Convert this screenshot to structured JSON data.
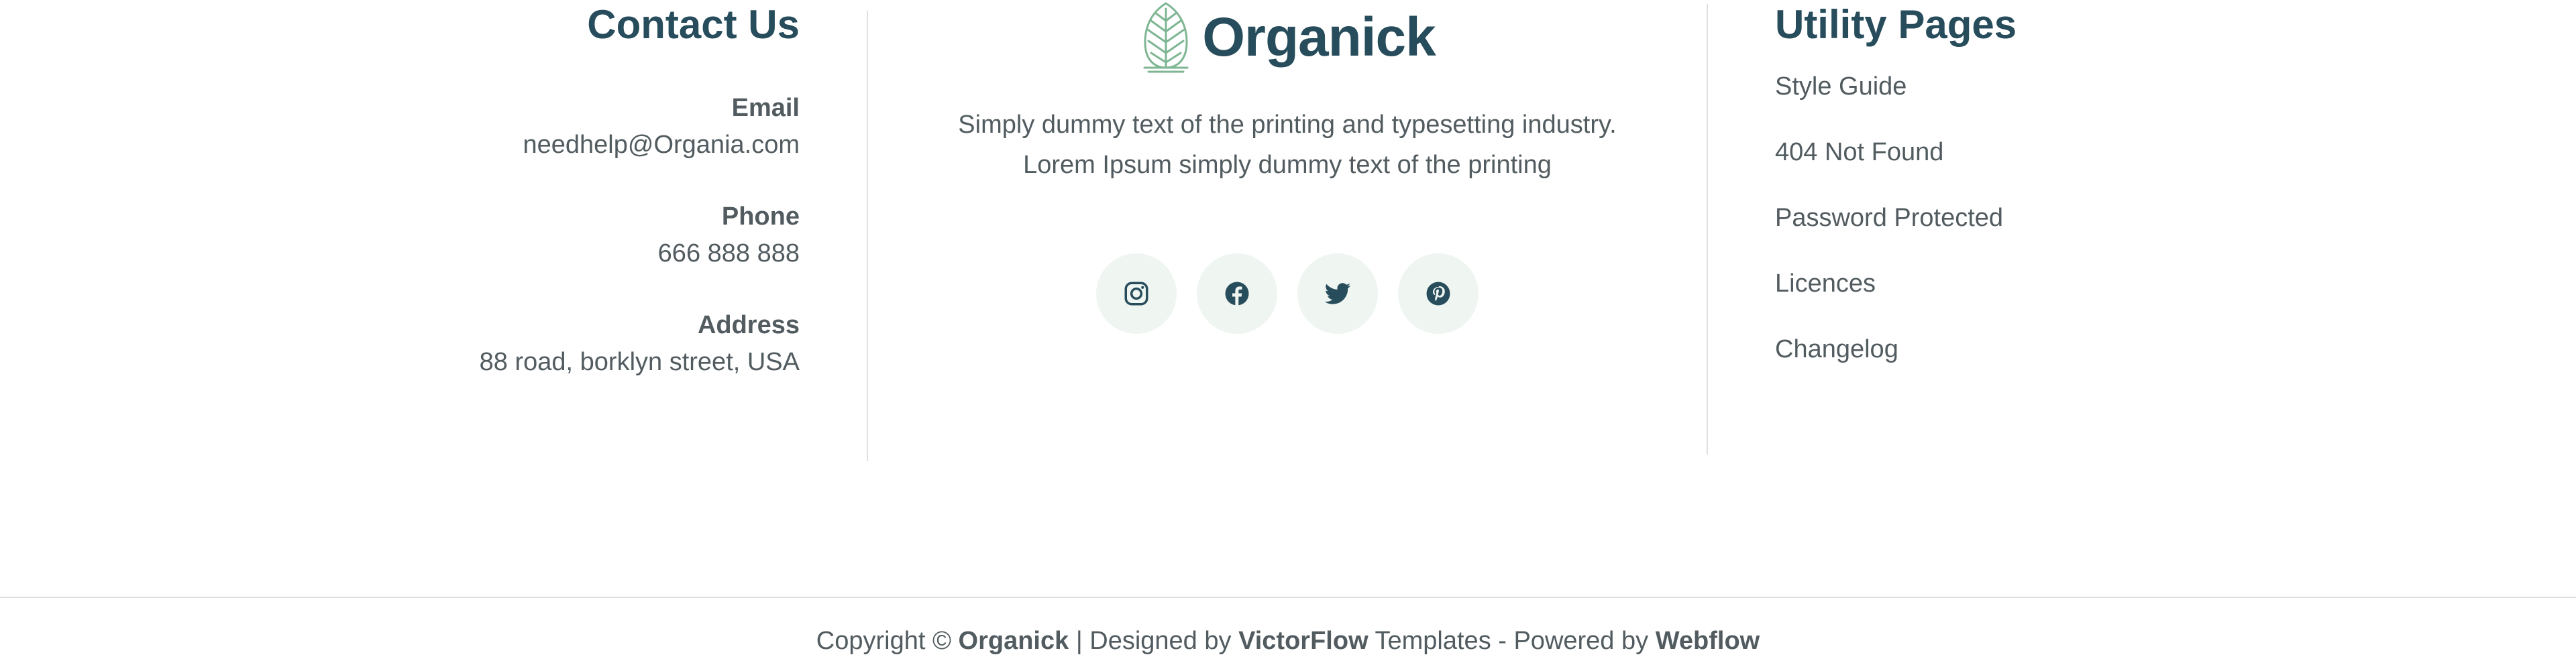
{
  "contact": {
    "heading": "Contact Us",
    "email_label": "Email",
    "email_value": "needhelp@Organia.com",
    "phone_label": "Phone",
    "phone_value": "666 888 888",
    "address_label": "Address",
    "address_value": "88 road, borklyn street, USA"
  },
  "brand": {
    "name": "Organick",
    "description_line1": "Simply dummy text of the printing and typesetting industry.",
    "description_line2": "Lorem Ipsum simply dummy text of the printing",
    "logo_icon": "leaf-logo-icon",
    "socials": [
      {
        "icon": "instagram-icon"
      },
      {
        "icon": "facebook-icon"
      },
      {
        "icon": "twitter-icon"
      },
      {
        "icon": "pinterest-icon"
      }
    ]
  },
  "utility": {
    "heading": "Utility Pages",
    "links": [
      "Style Guide",
      "404 Not Found",
      "Password Protected",
      "Licences",
      "Changelog"
    ]
  },
  "footer": {
    "copyright_prefix": "Copyright ©",
    "brand": "Organick",
    "designed_by_text": "| Designed by",
    "designer": "VictorFlow",
    "powered_text": "Templates - Powered by",
    "platform": "Webflow"
  },
  "colors": {
    "heading": "#274C5B",
    "text": "#525C60",
    "accent_green": "#7EB693",
    "social_bg": "#EFF6F1",
    "divider": "#E0E0E0"
  }
}
